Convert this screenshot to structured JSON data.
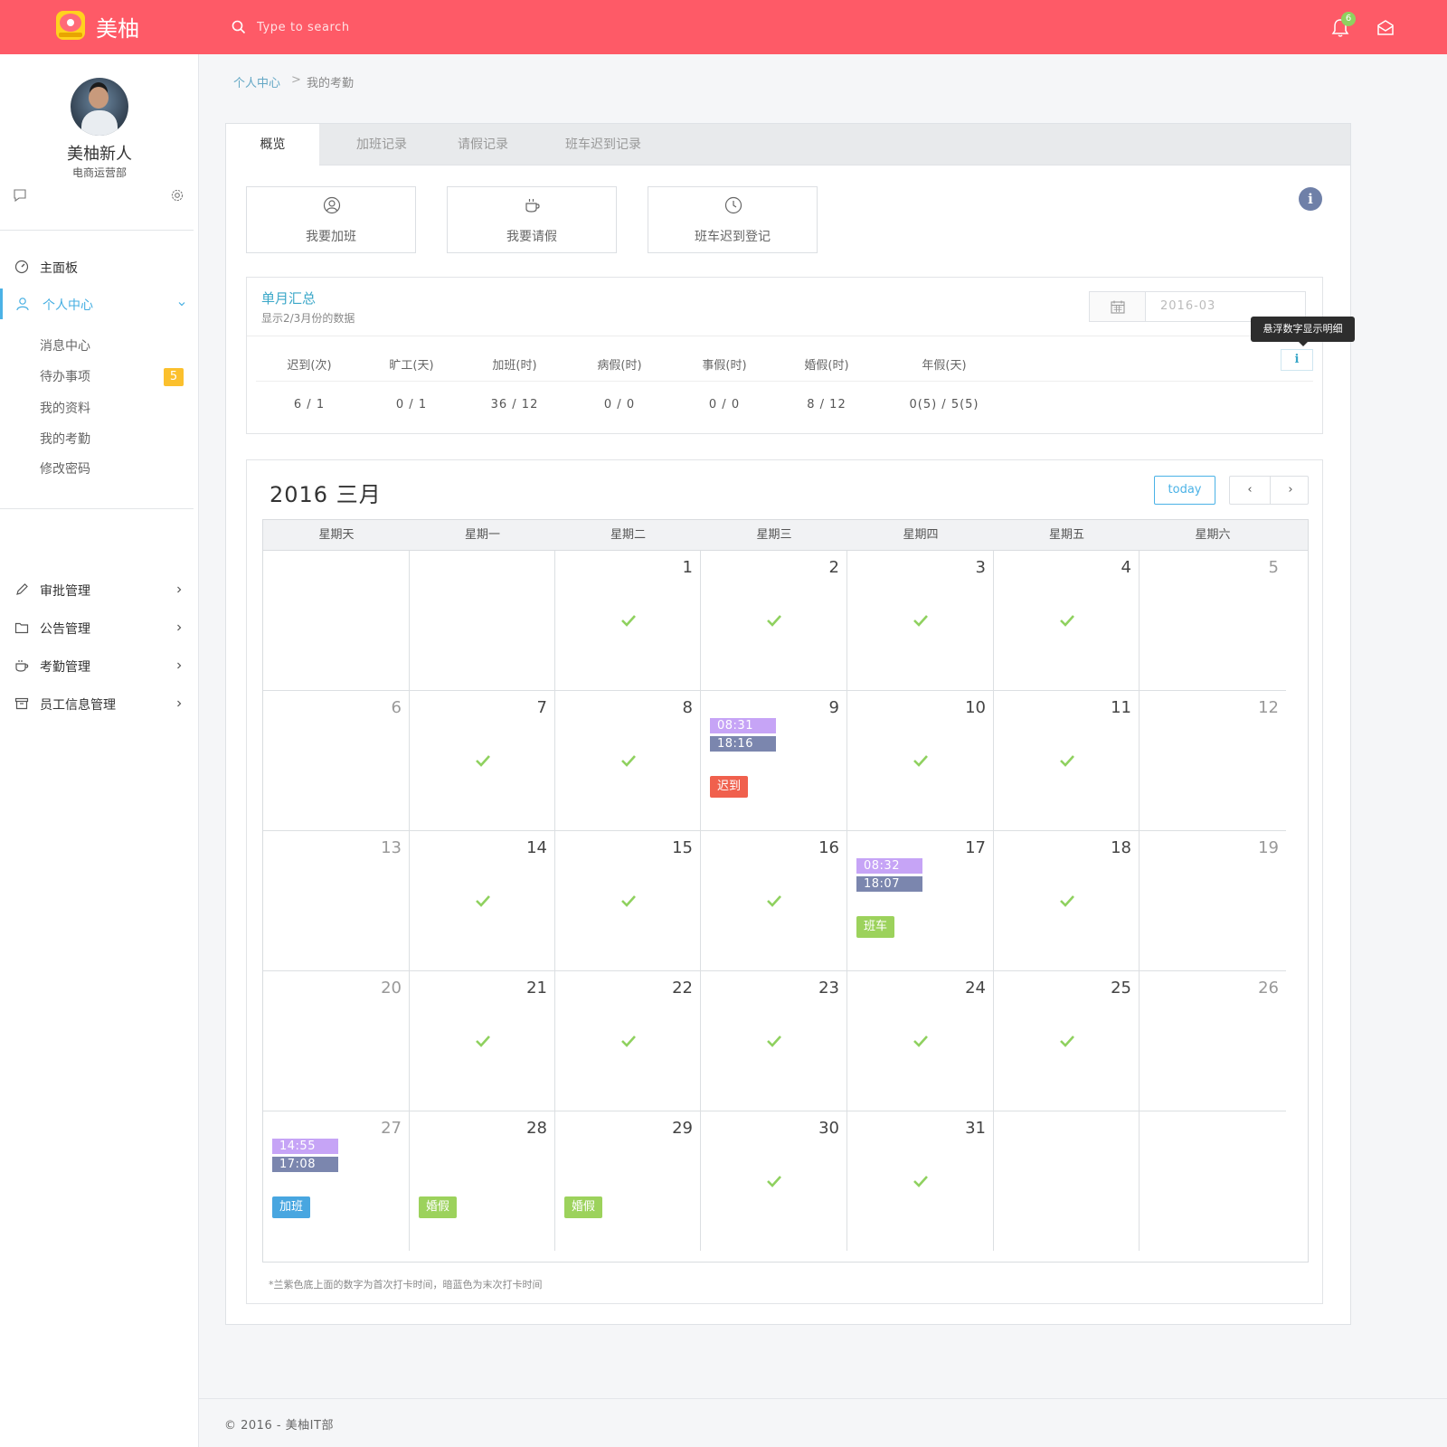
{
  "header": {
    "brand": "美柚",
    "search_placeholder": "Type to search",
    "notification_count": "6",
    "accent_color": "#fe5a67"
  },
  "user": {
    "name": "美柚新人",
    "department": "电商运营部"
  },
  "sidebar": {
    "items": [
      {
        "label": "主面板",
        "icon": "dashboard-icon"
      },
      {
        "label": "个人中心",
        "icon": "user-icon",
        "active": true
      },
      {
        "label": "审批管理",
        "icon": "pencil-icon"
      },
      {
        "label": "公告管理",
        "icon": "folder-icon"
      },
      {
        "label": "考勤管理",
        "icon": "coffee-icon"
      },
      {
        "label": "员工信息管理",
        "icon": "archive-icon"
      }
    ],
    "subitems": [
      "消息中心",
      "待办事项",
      "我的资料",
      "我的考勤",
      "修改密码"
    ],
    "todo_badge": "5"
  },
  "breadcrumb": {
    "parent": "个人中心",
    "separator": ">",
    "current": "我的考勤"
  },
  "tabs": [
    "概览",
    "加班记录",
    "请假记录",
    "班车迟到记录"
  ],
  "actions": [
    "我要加班",
    "我要请假",
    "班车迟到登记"
  ],
  "summary": {
    "title": "单月汇总",
    "subtitle": "显示2/3月份的数据",
    "month": "2016-03",
    "tooltip": "悬浮数字显示明细",
    "info_glyph": "i",
    "headers": [
      "迟到(次)",
      "旷工(天)",
      "加班(时)",
      "病假(时)",
      "事假(时)",
      "婚假(时)",
      "年假(天)"
    ],
    "values": [
      "6 / 1",
      "0 / 1",
      "36 / 12",
      "0 / 0",
      "0 / 0",
      "8 / 12",
      "0(5) / 5(5)"
    ]
  },
  "calendar": {
    "title": "2016 三月",
    "today_label": "today",
    "prev_label": "‹",
    "next_label": "›",
    "weekdays": [
      "星期天",
      "星期一",
      "星期二",
      "星期三",
      "星期四",
      "星期五",
      "星期六"
    ],
    "weeks": [
      [
        "",
        "",
        "1",
        "2",
        "3",
        "4",
        "5"
      ],
      [
        "6",
        "7",
        "8",
        "9",
        "10",
        "11",
        "12"
      ],
      [
        "13",
        "14",
        "15",
        "16",
        "17",
        "18",
        "19"
      ],
      [
        "20",
        "21",
        "22",
        "23",
        "24",
        "25",
        "26"
      ],
      [
        "27",
        "28",
        "29",
        "30",
        "31",
        "",
        ""
      ]
    ],
    "events": {
      "day9": {
        "first": "08:31",
        "last": "18:16",
        "tag": "迟到"
      },
      "day17": {
        "first": "08:32",
        "last": "18:07",
        "tag": "班车"
      },
      "day27": {
        "first": "14:55",
        "last": "17:08",
        "tag": "加班"
      },
      "day28": {
        "tag": "婚假"
      },
      "day29": {
        "tag": "婚假"
      }
    },
    "colors": {
      "first_punch": "#c6a4f6",
      "last_punch": "#7b86ae",
      "late": "#f0604d",
      "shuttle": "#9cd25c",
      "overtime": "#48a6e0",
      "marriage_leave": "#9cd25c",
      "check": "#8fd15f"
    },
    "note": "*兰紫色底上面的数字为首次打卡时间，暗蓝色为末次打卡时间"
  },
  "footer": "© 2016 - 美柚IT部"
}
